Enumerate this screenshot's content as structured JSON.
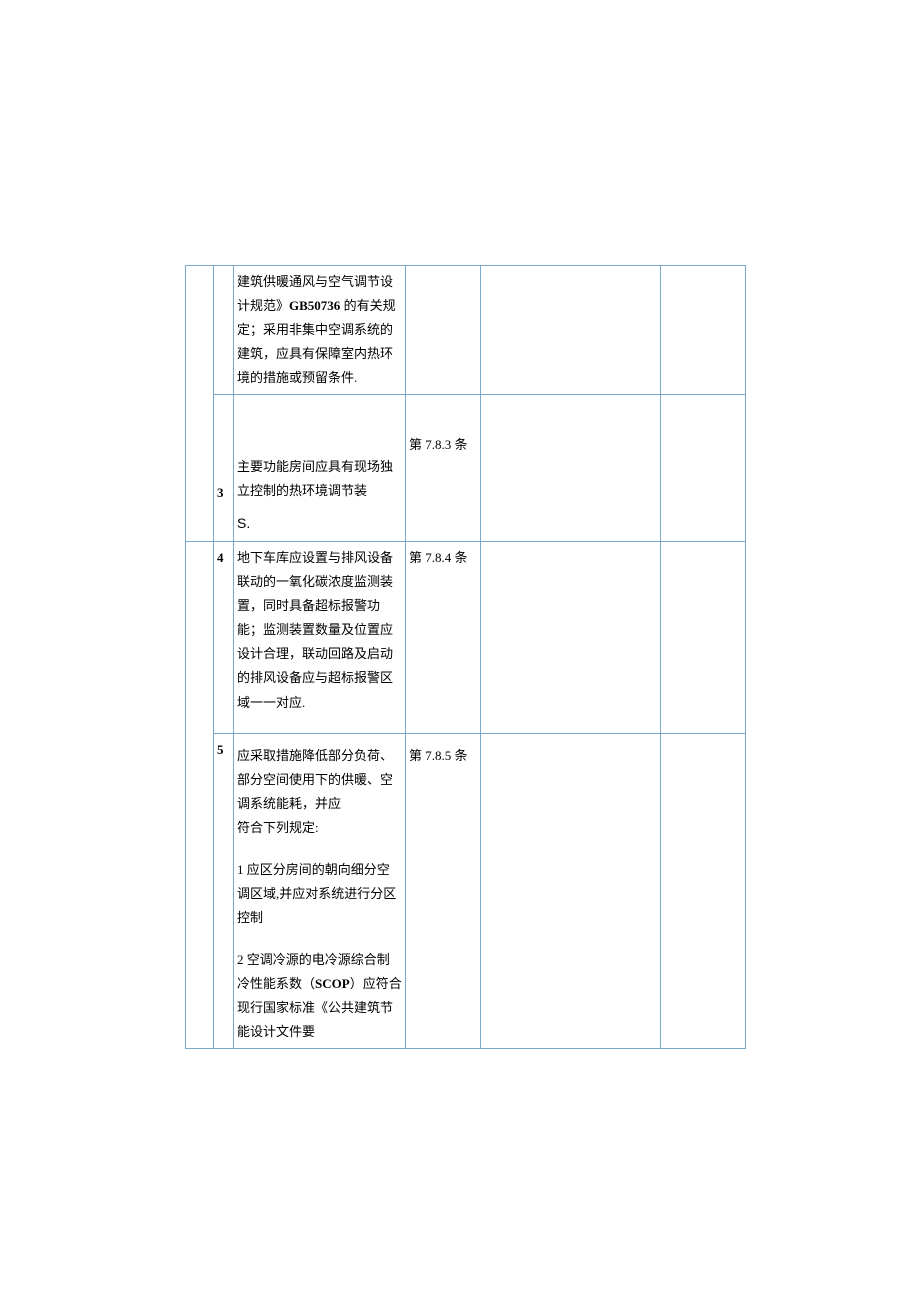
{
  "rows": [
    {
      "num": "",
      "content": "建筑供暖通风与空气调节设计规范》GB50736 的有关规定；采用非集中空调系统的建筑，应具有保障室内热环境的措施或预留条件.",
      "ref": ""
    },
    {
      "num": "3",
      "content_top": "主要功能房间应具有现场独立控制的热环境调节装",
      "content_bottom": "S.",
      "ref": "第 7.8.3 条"
    },
    {
      "num": "4",
      "content": "地下车库应设置与排风设备联动的一氧化碳浓度监测装置，同时具备超标报警功能；监测装置数量及位置应设计合理，联动回路及启动的排风设备应与超标报警区域一一对应.",
      "ref": "第 7.8.4 条"
    },
    {
      "num": "5",
      "content_p1": "应采取措施降低部分负荷、部分空间使用下的供暖、空调系统能耗，并应\n符合下列规定:",
      "content_p2": "1 应区分房间的朝向细分空调区域,并应对系统进行分区控制",
      "content_p3": "2 空调冷源的电冷源综合制冷性能系数（SCOP）应符合现行国家标准《公共建筑节能设计文件要",
      "ref": "第 7.8.5 条"
    }
  ]
}
